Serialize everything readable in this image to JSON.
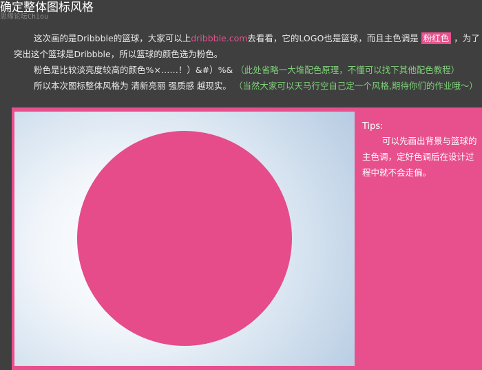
{
  "header": {
    "title": "确定整体图标风格",
    "watermark": "思缘论坛Chiou"
  },
  "intro": {
    "line1_before": "这次画的是Dribbble的篮球，大家可以上",
    "line1_link": "dribbble.com",
    "line1_after": "去看看，它的LOGO也是篮球，而且主色调是",
    "line1_highlight": "粉红色",
    "line1_end": "，为了",
    "line2": "突出这个篮球是Dribbble，所以篮球的颜色选为粉色。",
    "line3_text": "粉色是比较淡亮度较高的颜色%×……！）&#）%&",
    "line3_note": "（此处省略一大堆配色原理，不懂可以找下其他配色教程）",
    "line4_text": "所以本次图标整体风格为 清新亮丽 强质感 越现实。",
    "line4_note": "（当然大家可以天马行空自己定一个风格,期待你们的作业哦～）"
  },
  "tips": {
    "title": "Tips:",
    "body": "可以先画出背景与篮球的主色调，定好色调后在设计过程中就不会走偏。"
  },
  "colors": {
    "pink": "#e8508d",
    "ball": "#e64b8a",
    "background": "#3f3f3f",
    "note_green": "#7fd07a"
  }
}
